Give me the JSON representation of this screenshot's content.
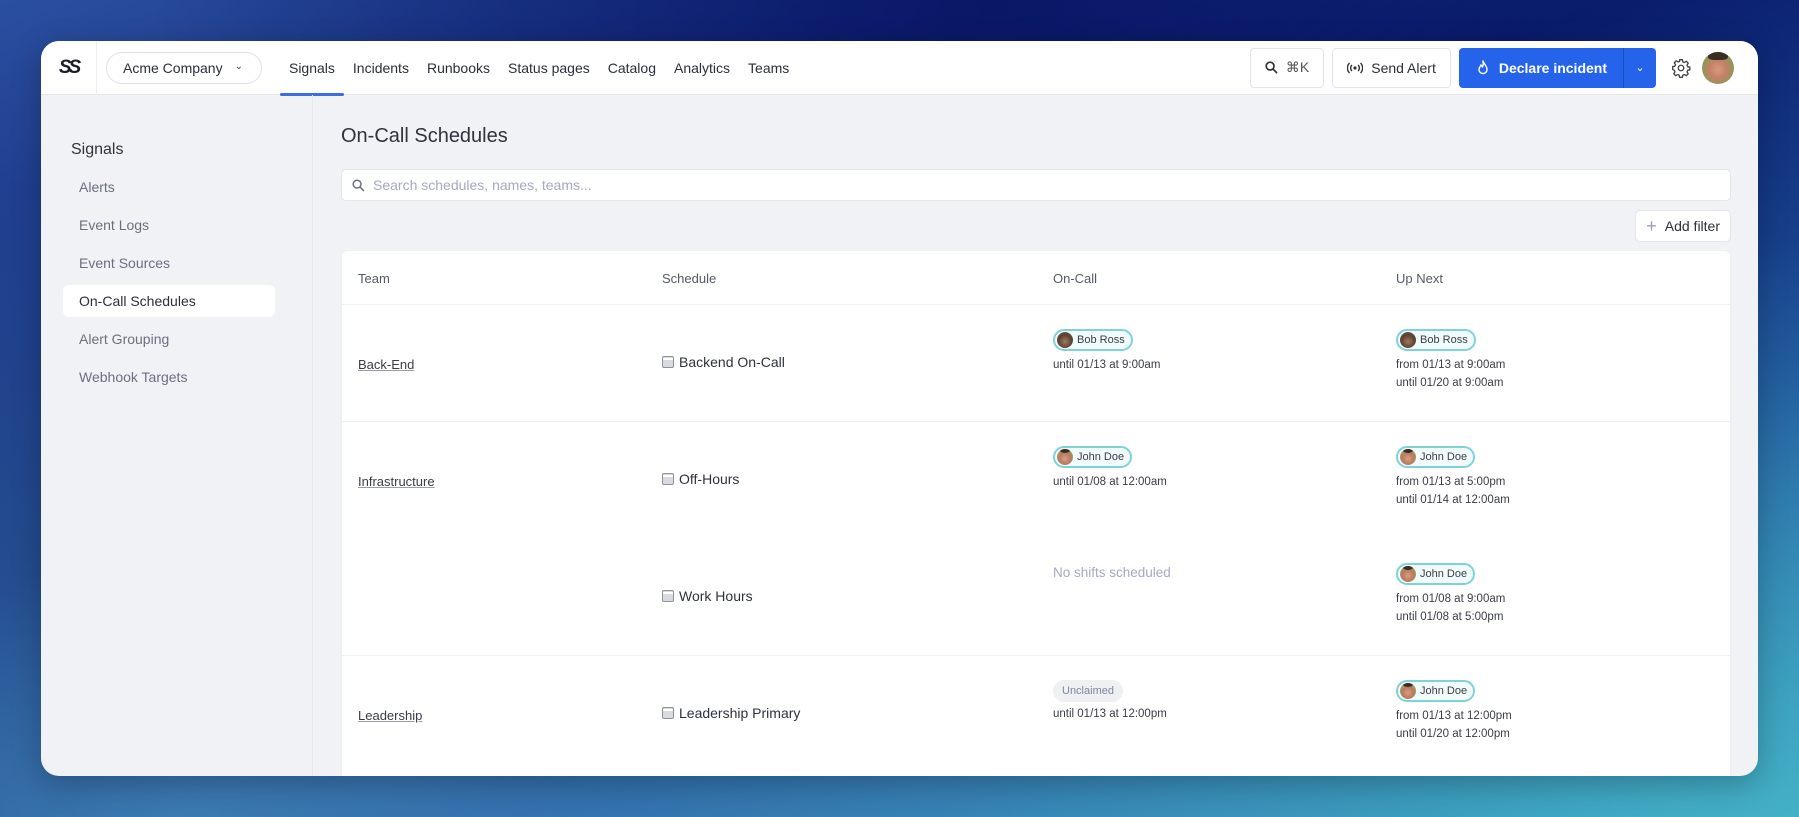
{
  "app": {
    "logo_glyph": "SS",
    "org": "Acme Company"
  },
  "nav": {
    "items": [
      {
        "label": "Signals",
        "active": true
      },
      {
        "label": "Incidents"
      },
      {
        "label": "Runbooks"
      },
      {
        "label": "Status pages"
      },
      {
        "label": "Catalog"
      },
      {
        "label": "Analytics"
      },
      {
        "label": "Teams"
      }
    ]
  },
  "actions": {
    "search_shortcut": "⌘K",
    "send_alert": "Send Alert",
    "declare_incident": "Declare incident",
    "primary_color": "#2563eb"
  },
  "sidebar": {
    "title": "Signals",
    "items": [
      {
        "label": "Alerts"
      },
      {
        "label": "Event Logs"
      },
      {
        "label": "Event Sources"
      },
      {
        "label": "On-Call Schedules",
        "active": true
      },
      {
        "label": "Alert Grouping"
      },
      {
        "label": "Webhook Targets"
      }
    ]
  },
  "main": {
    "title": "On-Call Schedules",
    "search_placeholder": "Search schedules, names, teams...",
    "add_filter": "Add filter",
    "columns": [
      "Team",
      "Schedule",
      "On-Call",
      "Up Next"
    ],
    "rows": [
      {
        "team": "Back-End",
        "schedules": [
          {
            "name": "Backend On-Call",
            "oncall": {
              "person": "Bob Ross",
              "until": "until 01/13 at 9:00am"
            },
            "upnext": {
              "person": "Bob Ross",
              "from": "from 01/13 at 9:00am",
              "until": "until 01/20 at 9:00am"
            }
          }
        ]
      },
      {
        "team": "Infrastructure",
        "schedules": [
          {
            "name": "Off-Hours",
            "oncall": {
              "person": "John Doe",
              "until": "until 01/08 at 12:00am"
            },
            "upnext": {
              "person": "John Doe",
              "from": "from 01/13 at 5:00pm",
              "until": "until 01/14 at 12:00am"
            }
          },
          {
            "name": "Work Hours",
            "oncall": {
              "empty": "No shifts scheduled"
            },
            "upnext": {
              "person": "John Doe",
              "from": "from 01/08 at 9:00am",
              "until": "until 01/08 at 5:00pm"
            }
          }
        ]
      },
      {
        "team": "Leadership",
        "schedules": [
          {
            "name": "Leadership Primary",
            "oncall": {
              "badge": "Unclaimed",
              "until": "until 01/13 at 12:00pm"
            },
            "upnext": {
              "person": "John Doe",
              "from": "from 01/13 at 12:00pm",
              "until": "until 01/20 at 12:00pm"
            }
          }
        ]
      }
    ]
  }
}
